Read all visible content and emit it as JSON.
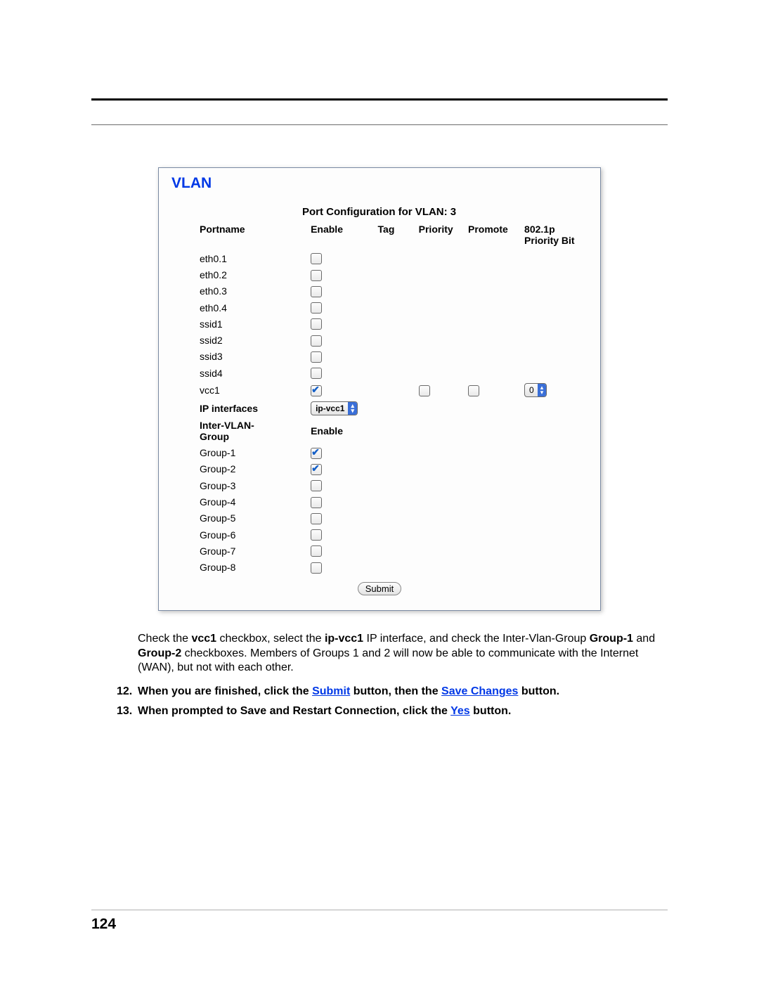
{
  "page_number": "124",
  "card": {
    "title": "VLAN",
    "config_heading": "Port Configuration for VLAN: 3",
    "headers": {
      "portname": "Portname",
      "enable": "Enable",
      "tag": "Tag",
      "priority": "Priority",
      "promote": "Promote",
      "p8021p_top": "802.1p",
      "p8021p_bottom": "Priority Bit"
    },
    "ports": [
      {
        "name": "eth0.1",
        "enable": false
      },
      {
        "name": "eth0.2",
        "enable": false
      },
      {
        "name": "eth0.3",
        "enable": false
      },
      {
        "name": "eth0.4",
        "enable": false
      },
      {
        "name": "ssid1",
        "enable": false
      },
      {
        "name": "ssid2",
        "enable": false
      },
      {
        "name": "ssid3",
        "enable": false
      },
      {
        "name": "ssid4",
        "enable": false
      }
    ],
    "vcc_row": {
      "name": "vcc1",
      "enable": true,
      "priority": false,
      "promote": false,
      "pbit_value": "0"
    },
    "ip_label": "IP interfaces",
    "ip_select": "ip-vcc1",
    "inter_vlan_label_top": "Inter-VLAN-",
    "inter_vlan_label_bottom": "Group",
    "inter_vlan_enable": "Enable",
    "groups": [
      {
        "name": "Group-1",
        "enable": true
      },
      {
        "name": "Group-2",
        "enable": true
      },
      {
        "name": "Group-3",
        "enable": false
      },
      {
        "name": "Group-4",
        "enable": false
      },
      {
        "name": "Group-5",
        "enable": false
      },
      {
        "name": "Group-6",
        "enable": false
      },
      {
        "name": "Group-7",
        "enable": false
      },
      {
        "name": "Group-8",
        "enable": false
      }
    ],
    "submit": "Submit"
  },
  "para": {
    "t1": "Check the ",
    "b1": "vcc1",
    "t2": " checkbox, select the ",
    "b2": "ip-vcc1",
    "t3": " IP interface, and check the Inter-Vlan-Group ",
    "b3": "Group-1",
    "t4": " and ",
    "b4": "Group-2",
    "t5": " checkboxes. Members of Groups 1 and 2 will now be able to communicate with the Internet (WAN), but not with each other."
  },
  "step12": {
    "num": "12.",
    "t1": "When you are finished, click the ",
    "l1": "Submit",
    "t2": " button, then the ",
    "l2": "Save Changes",
    "t3": " button."
  },
  "step13": {
    "num": "13.",
    "t1": "When prompted to Save and Restart Connection, click the ",
    "l1": "Yes",
    "t2": " button."
  }
}
